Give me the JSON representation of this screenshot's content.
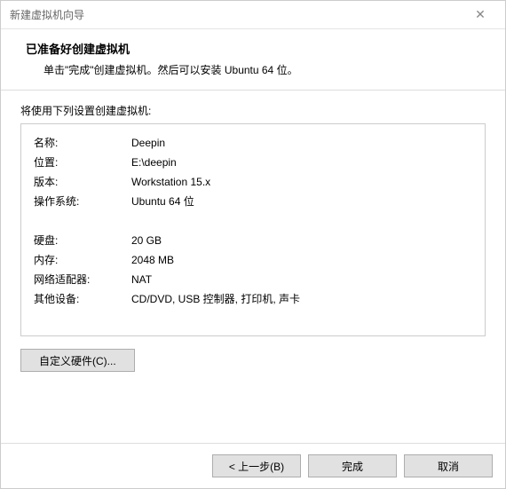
{
  "window": {
    "title": "新建虚拟机向导"
  },
  "header": {
    "heading": "已准备好创建虚拟机",
    "sub": "单击\"完成\"创建虚拟机。然后可以安装 Ubuntu 64 位。"
  },
  "intro": "将使用下列设置创建虚拟机:",
  "settings": {
    "name_label": "名称:",
    "name_value": "Deepin",
    "location_label": "位置:",
    "location_value": "E:\\deepin",
    "version_label": "版本:",
    "version_value": "Workstation 15.x",
    "os_label": "操作系统:",
    "os_value": "Ubuntu 64 位",
    "disk_label": "硬盘:",
    "disk_value": "20 GB",
    "memory_label": "内存:",
    "memory_value": "2048 MB",
    "net_label": "网络适配器:",
    "net_value": "NAT",
    "other_label": "其他设备:",
    "other_value": "CD/DVD, USB 控制器, 打印机, 声卡"
  },
  "buttons": {
    "customize": "自定义硬件(C)...",
    "back": "< 上一步(B)",
    "finish": "完成",
    "cancel": "取消"
  }
}
